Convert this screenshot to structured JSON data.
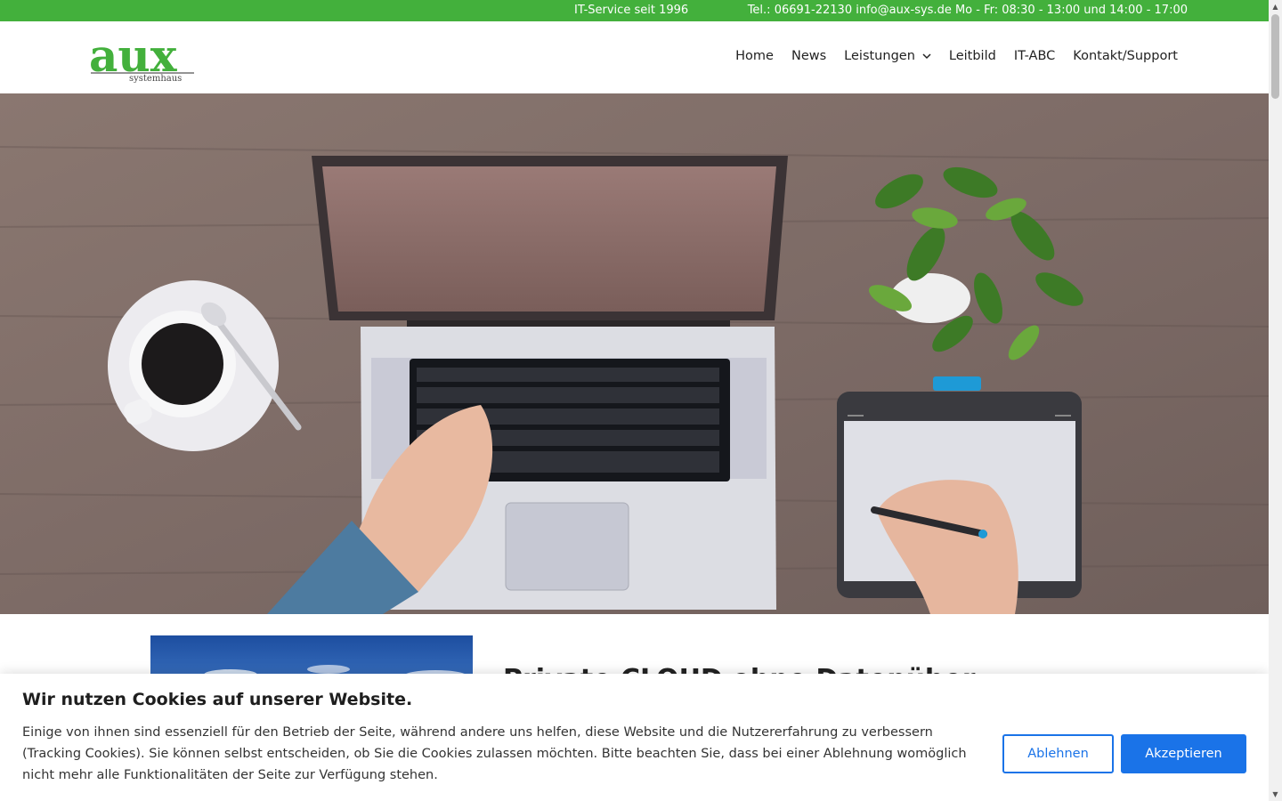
{
  "topbar": {
    "since": "IT-Service seit 1996",
    "contact": "Tel.: 06691-22130 info@aux-sys.de Mo - Fr: 08:30 - 13:00 und 14:00 - 17:00"
  },
  "logo": {
    "wordmark": "aux",
    "subtitle": "systemhaus"
  },
  "nav": {
    "items": [
      {
        "label": "Home"
      },
      {
        "label": "News"
      },
      {
        "label": "Leistungen"
      },
      {
        "label": "Leitbild"
      },
      {
        "label": "IT-ABC"
      },
      {
        "label": "Kontakt/Support"
      }
    ],
    "dropdown_icon": "chevron-down-icon"
  },
  "content": {
    "heading": "Private CLOUD ohne Datenüber"
  },
  "cookie": {
    "title": "Wir nutzen Cookies auf unserer Website.",
    "text": "Einige von ihnen sind essenziell für den Betrieb der Seite, während andere uns helfen, diese Website und die Nutzererfahrung zu verbessern (Tracking Cookies). Sie können selbst entscheiden, ob Sie die Cookies zulassen möchten. Bitte beachten Sie, dass bei einer Ablehnung womöglich nicht mehr alle Funktionalitäten der Seite zur Verfügung stehen.",
    "decline_label": "Ablehnen",
    "accept_label": "Akzeptieren"
  },
  "colors": {
    "brand_green": "#43b03c",
    "button_blue": "#1a73e8"
  }
}
